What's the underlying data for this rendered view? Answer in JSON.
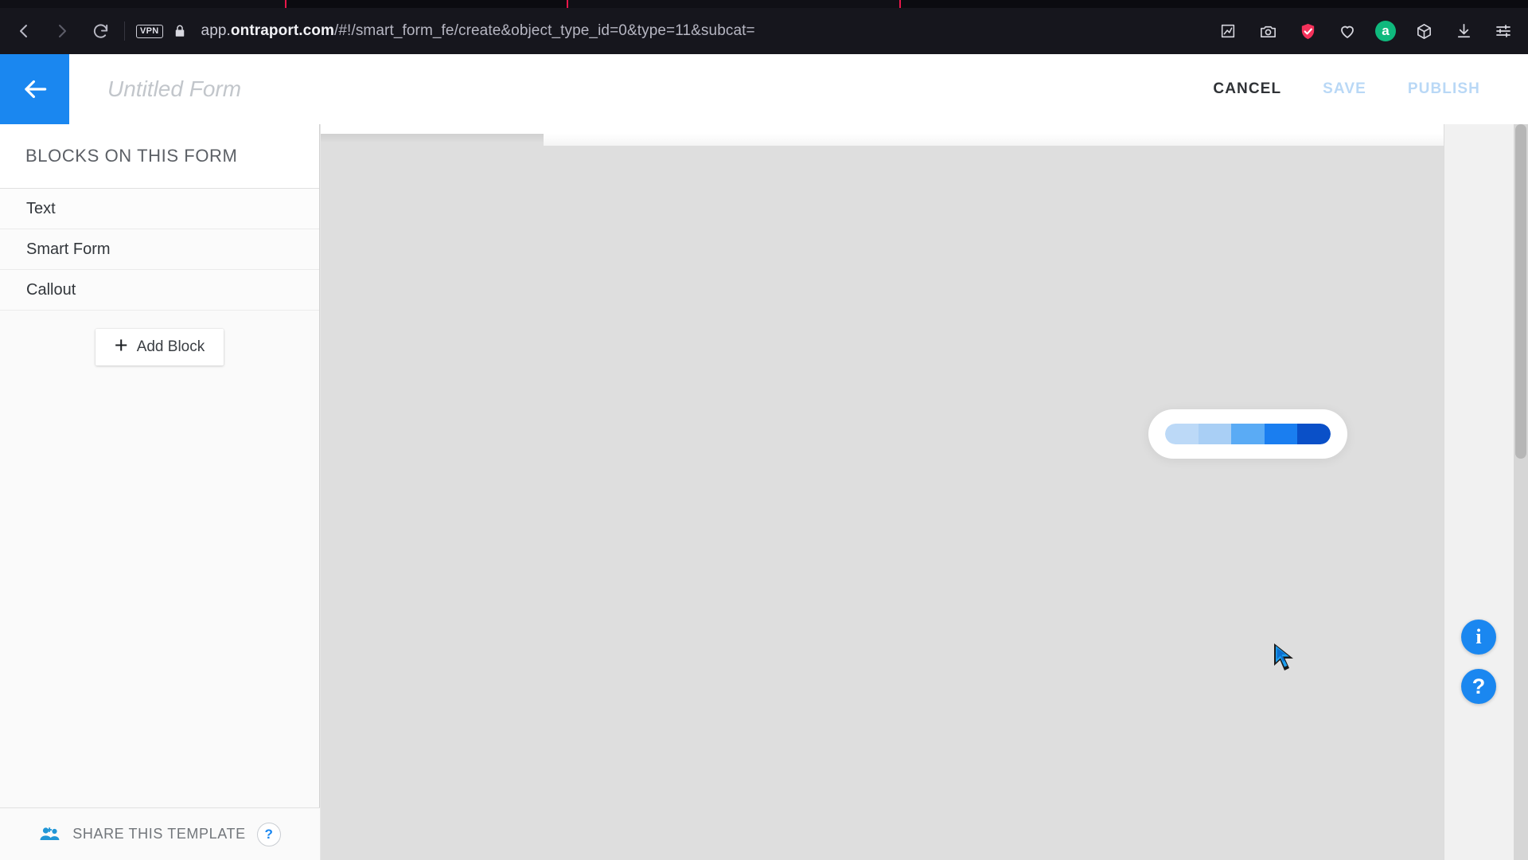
{
  "browser": {
    "nav": {
      "back_icon": "arrow-left-icon",
      "forward_icon": "arrow-right-icon",
      "reload_icon": "reload-icon"
    },
    "vpn_badge": "VPN",
    "lock_icon": "lock-icon",
    "url": {
      "full": "app.ontraport.com/#!/smart_form_fe/create&object_type_id=0&type=11&subcat=",
      "prefix": "app.",
      "host_bold": "ontraport.com",
      "path": "/#!/smart_form_fe/create&object_type_id=0&type=11&subcat="
    },
    "extensions": [
      {
        "name": "edit-pin-icon",
        "label": ""
      },
      {
        "name": "camera-icon",
        "label": ""
      },
      {
        "name": "shield-check-icon",
        "label": "",
        "color": "#f5325b"
      },
      {
        "name": "heart-icon",
        "label": ""
      },
      {
        "name": "adguard-icon",
        "label": "a",
        "color": "#0fb97d"
      },
      {
        "name": "cube-icon",
        "label": ""
      },
      {
        "name": "download-icon",
        "label": ""
      },
      {
        "name": "settings-sliders-icon",
        "label": ""
      }
    ],
    "tab_accent_color": "#e8174a"
  },
  "app_header": {
    "back_icon": "arrow-left-icon",
    "back_button_color": "#1a87f0",
    "form_title_value": "",
    "form_title_placeholder": "Untitled Form",
    "actions": [
      {
        "name": "cancel-button",
        "label": "CANCEL",
        "state": "enabled"
      },
      {
        "name": "save-button",
        "label": "SAVE",
        "state": "disabled"
      },
      {
        "name": "publish-button",
        "label": "PUBLISH",
        "state": "disabled"
      }
    ],
    "cancel_label": "CANCEL",
    "save_label": "SAVE",
    "publish_label": "PUBLISH"
  },
  "sidebar": {
    "title": "BLOCKS ON THIS FORM",
    "blocks": [
      {
        "label": "Text"
      },
      {
        "label": "Smart Form"
      },
      {
        "label": "Callout"
      }
    ],
    "add_block_label": "Add Block",
    "add_block_icon": "plus-icon",
    "share_label": "SHARE THIS TEMPLATE",
    "share_icon": "people-add-icon",
    "help_label": "?"
  },
  "canvas": {
    "loading": {
      "name": "loading-progress-bar",
      "segments": 5,
      "colors": [
        "#bcd9f7",
        "#a9cff5",
        "#5aabf5",
        "#1a7ef0",
        "#0a50c8"
      ]
    },
    "cursor_icon": "custom-pointer-cursor"
  },
  "right_panel": {
    "fabs": [
      {
        "name": "info-fab",
        "label": "i"
      },
      {
        "name": "help-fab",
        "label": "?"
      }
    ],
    "info_label": "i",
    "help_label": "?",
    "accent_color": "#1a87f0"
  }
}
